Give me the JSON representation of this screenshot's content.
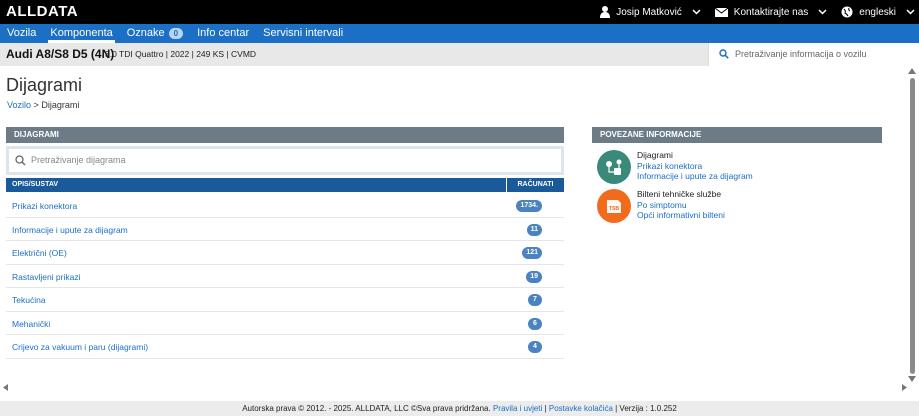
{
  "header": {
    "logo": "ALLDATA",
    "user_name": "Josip Matković",
    "contact_label": "Kontaktirajte nas",
    "language_label": "engleski"
  },
  "nav": {
    "items": [
      {
        "label": "Vozila"
      },
      {
        "label": "Komponenta"
      },
      {
        "label": "Oznake"
      },
      {
        "label": "Info centar"
      },
      {
        "label": "Servisni intervali"
      }
    ],
    "active_index": 1,
    "tags_count": "0"
  },
  "vehicle": {
    "name": "Audi A8/S8 D5 (4N)",
    "specs": "3.0 TDI Quattro | 2022 | 249 KS | CVMD",
    "search_placeholder": "Pretraživanje informacija o vozilu"
  },
  "page": {
    "title": "Dijagrami",
    "breadcrumb_link": "Vozilo",
    "breadcrumb_separator": ">",
    "breadcrumb_current": "Dijagrami"
  },
  "diagrams": {
    "header": "DIJAGRAMI",
    "search_placeholder": "Pretraživanje dijagrama",
    "col_desc": "OPIS/SUSTAV",
    "col_count": "RAČUNATI",
    "rows": [
      {
        "label": "Prikazi konektora",
        "count": "1734."
      },
      {
        "label": "Informacije i upute za dijagram",
        "count": "11"
      },
      {
        "label": "Električni (OE)",
        "count": "121"
      },
      {
        "label": "Rastavljeni prikazi",
        "count": "19"
      },
      {
        "label": "Tekućina",
        "count": "7"
      },
      {
        "label": "Mehanički",
        "count": "6"
      },
      {
        "label": "Crijevo za vakuum i paru (dijagrami)",
        "count": "4"
      }
    ]
  },
  "related": {
    "header": "POVEZANE INFORMACIJE",
    "groups": [
      {
        "title": "Dijagrami",
        "icon": "diagram-icon",
        "color": "#3a8a7a",
        "links": [
          "Prikazi konektora",
          "Informacije i upute za dijagram"
        ]
      },
      {
        "title": "Bilteni tehničke službe",
        "icon": "tsb-icon",
        "color": "#f26a1b",
        "icon_text": "TSB",
        "links": [
          "Po simptomu",
          "Opći informativni bilteni"
        ]
      }
    ]
  },
  "footer": {
    "copyright": "Autorska prava © 2012. - 2025. ALLDATA, LLC ©Sva prava pridržana.",
    "terms_link": "Pravila i uvjeti",
    "cookies_link": "Postavke kolačića",
    "version": "| Verzija : 1.0.252"
  },
  "colors": {
    "nav_blue": "#1b6fc4",
    "table_head": "#1b5a9a",
    "panel_header": "#6d7b87"
  }
}
